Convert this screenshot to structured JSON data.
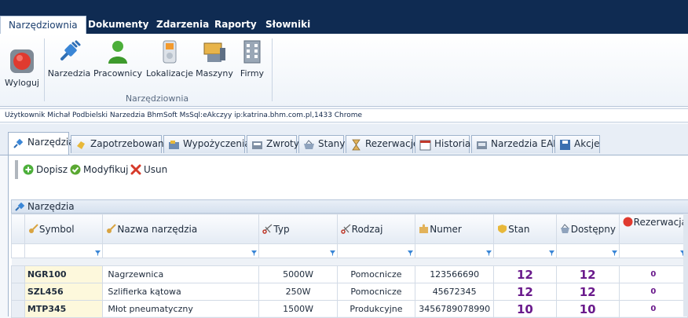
{
  "menu": {
    "tabs": [
      "Narzędziownia",
      "Dokumenty",
      "Zdarzenia",
      "Raporty",
      "Słowniki"
    ]
  },
  "ribbon": {
    "logout_label": "Wyloguj",
    "buttons": [
      "Narzedzia",
      "Pracownicy",
      "Lokalizacje",
      "Maszyny",
      "Firmy"
    ],
    "group_label": "Narzędziownia"
  },
  "infobar": {
    "text": "Użytkownik Michał Podbielski Narzedzia BhmSoft MsSql:eAkczyy ip:katrina.bhm.com.pl,1433 Chrome"
  },
  "tabs": [
    "Narzędzia",
    "Zapotrzebowania",
    "Wypożyczenia",
    "Zwroty",
    "Stany",
    "Rezerwacje",
    "Historia",
    "Narzedzia EAN",
    "Akcje"
  ],
  "actions": {
    "add": "Dopisz",
    "edit": "Modyfikuj",
    "delete": "Usun"
  },
  "grid": {
    "title": "Narzędzia",
    "columns": [
      "Symbol",
      "Nazwa narzędzia",
      "Typ",
      "Rodzaj",
      "Numer",
      "Stan",
      "Dostępny",
      "Rezerwacja"
    ],
    "rows": [
      {
        "symbol": "NGR100",
        "name": "Nagrzewnica",
        "type": "5000W",
        "kind": "Pomocnicze",
        "number": "123566690",
        "stan": "12",
        "available": "12",
        "reservation": "0"
      },
      {
        "symbol": "SZL456",
        "name": "Szlifierka kątowa",
        "type": "250W",
        "kind": "Pomocnicze",
        "number": "45672345",
        "stan": "12",
        "available": "12",
        "reservation": "0"
      },
      {
        "symbol": "MTP345",
        "name": "Młot pneumatyczny",
        "type": "1500W",
        "kind": "Produkcyjne",
        "number": "3456789078990",
        "stan": "10",
        "available": "10",
        "reservation": "0"
      }
    ]
  },
  "colors": {
    "menubar": "#0f2b52",
    "accent_purple": "#6a1a8c",
    "symbol_cell": "#fdf8dc"
  }
}
